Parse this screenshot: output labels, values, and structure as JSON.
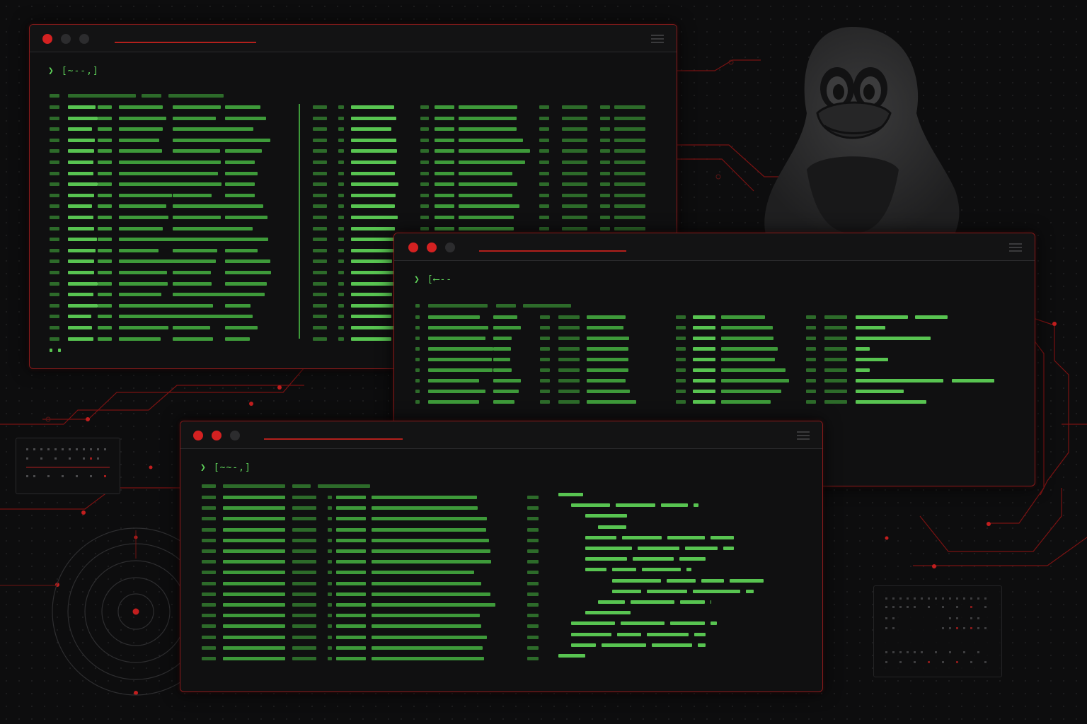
{
  "terminals": [
    {
      "id": "term-1",
      "prompt": "[~--,]"
    },
    {
      "id": "term-2",
      "prompt": "[⟵--"
    },
    {
      "id": "term-3",
      "prompt": "[~~-,]"
    }
  ],
  "colors": {
    "background": "#0d0d0e",
    "accent_red": "#d42121",
    "terminal_green": "#58c451",
    "border": "#8a1a1a"
  },
  "icons": [
    "penguin-mascot",
    "close-dot",
    "menu-icon",
    "radar-circle"
  ]
}
